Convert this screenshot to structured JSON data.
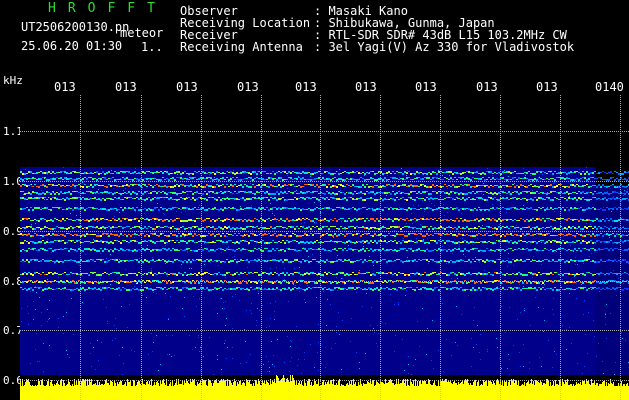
{
  "app": {
    "title": "HROFFT",
    "filename": "UT2506200130.pn",
    "tag": "meteor",
    "datetime": "25.06.20 01:30",
    "seq": "1.."
  },
  "info": {
    "labels": [
      "Observer",
      "Receiving Location",
      "Receiver",
      "Receiving Antenna"
    ],
    "values": [
      ": Masaki Kano",
      ": Shibukawa, Gunma, Japan",
      ": RTL-SDR SDR# 43dB L15 103.2MHz CW",
      ": 3el Yagi(V) Az 330 for Vladivostok"
    ]
  },
  "axis": {
    "unit": "kHz",
    "x_labels": [
      "013",
      "013",
      "013",
      "013",
      "013",
      "013",
      "013",
      "013",
      "013",
      "0140"
    ],
    "y_labels": [
      "1.1",
      "1.0",
      "0.9",
      "0.8",
      "0.7",
      "0.6"
    ]
  },
  "colors": {
    "background": "#000000",
    "waterfall_bg": "#00008b",
    "title_green": "#2fdc2f",
    "audio_level": "#ffff00"
  }
}
